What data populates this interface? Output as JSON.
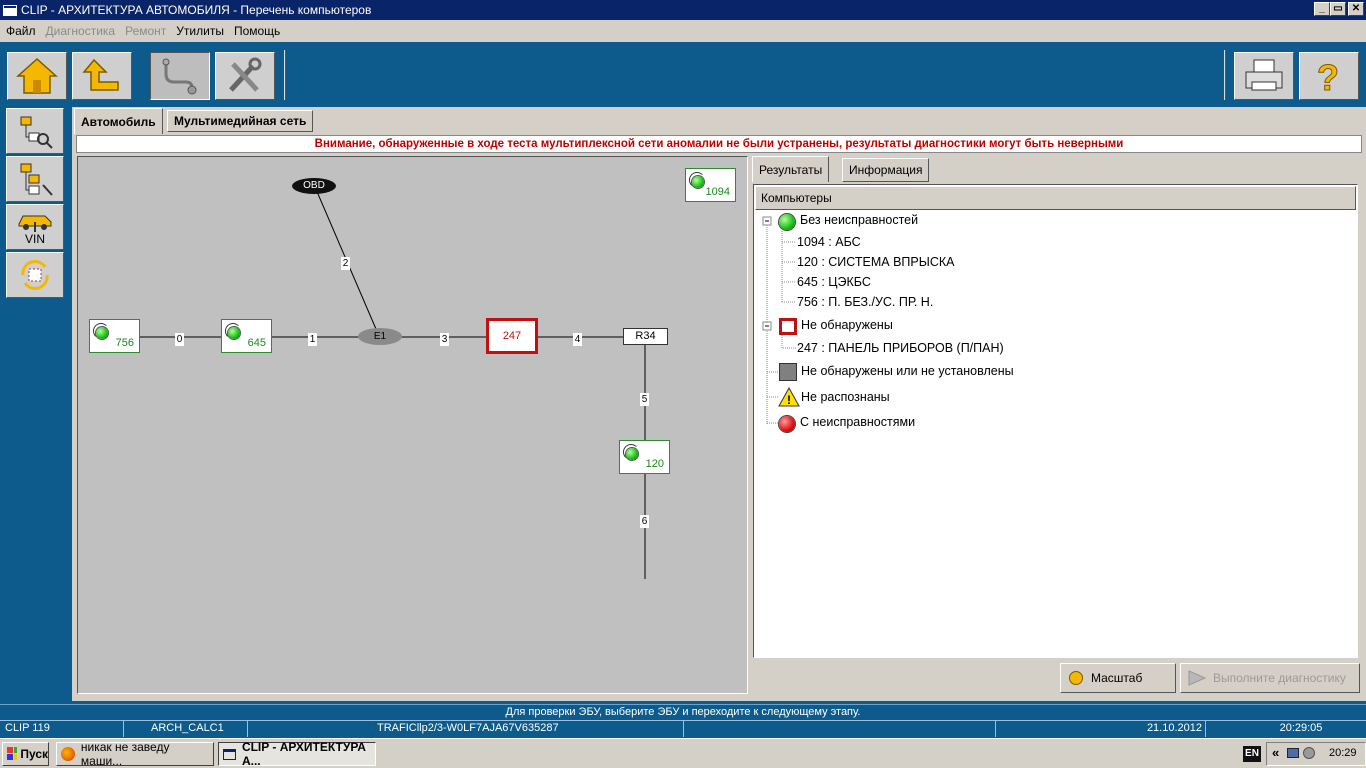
{
  "window": {
    "title": "CLIP - АРХИТЕКТУРА АВТОМОБИЛЯ - Перечень компьютеров",
    "minimize": "_",
    "maximize": "▭",
    "close": "✕"
  },
  "menu": [
    {
      "label": "Файл",
      "disabled": false
    },
    {
      "label": "Диагностика",
      "disabled": true
    },
    {
      "label": "Ремонт",
      "disabled": true
    },
    {
      "label": "Утилиты",
      "disabled": false
    },
    {
      "label": "Помощь",
      "disabled": false
    }
  ],
  "sidebar": {
    "vin_label": "VIN"
  },
  "tabs": {
    "auto": "Автомобиль",
    "multimedia": "Мультимедийная сеть"
  },
  "warning": "Внимание, обнаруженные в ходе теста мультиплексной сети аномалии не были устранены, результаты диагностики могут быть неверными",
  "diagram": {
    "obd": "OBD",
    "e1": "E1",
    "r34": "R34",
    "node_247": "247",
    "nodes": {
      "n756": "756",
      "n645": "645",
      "n120": "120",
      "n1094": "1094"
    },
    "links": {
      "l0": "0",
      "l1": "1",
      "l2": "2",
      "l3": "3",
      "l4": "4",
      "l5": "5",
      "l6": "6"
    }
  },
  "results": {
    "tab_results": "Результаты",
    "tab_info": "Информация",
    "header": "Компьютеры",
    "group_ok": "Без неисправностей",
    "ok_items": [
      "1094 : АБС",
      "120 : СИСТЕМА ВПРЫСКА",
      "645 : ЦЭКБС",
      "756 : П. БЕЗ./УС. ПР. Н."
    ],
    "group_not_detected": "Не обнаружены",
    "not_detected_items": [
      "247 : ПАНЕЛЬ ПРИБОРОВ (П/ПАН)"
    ],
    "group_not_installed": "Не обнаружены или не установлены",
    "group_unrecognized": "Не распознаны",
    "group_faulty": "С неисправностями"
  },
  "buttons": {
    "zoom": "Масштаб",
    "diagnose": "Выполните диагностику"
  },
  "hint": "Для проверки ЭБУ, выберите ЭБУ и переходите к следующему этапу.",
  "status": {
    "clip": "CLIP 119",
    "calc": "ARCH_CALC1",
    "vehicle": "TRAFICllp2/3-W0LF7AJA67V635287",
    "date": "21.10.2012",
    "time": "20:29:05"
  },
  "taskbar": {
    "start": "Пуск",
    "firefox": "никак не заведу маши...",
    "clip": "CLIP - АРХИТЕКТУРА А...",
    "lang": "EN",
    "clock": "20:29"
  },
  "colors": {
    "accent_blue": "#0d5b8c",
    "warning_red": "#c00000",
    "ok_green": "#16c016"
  }
}
